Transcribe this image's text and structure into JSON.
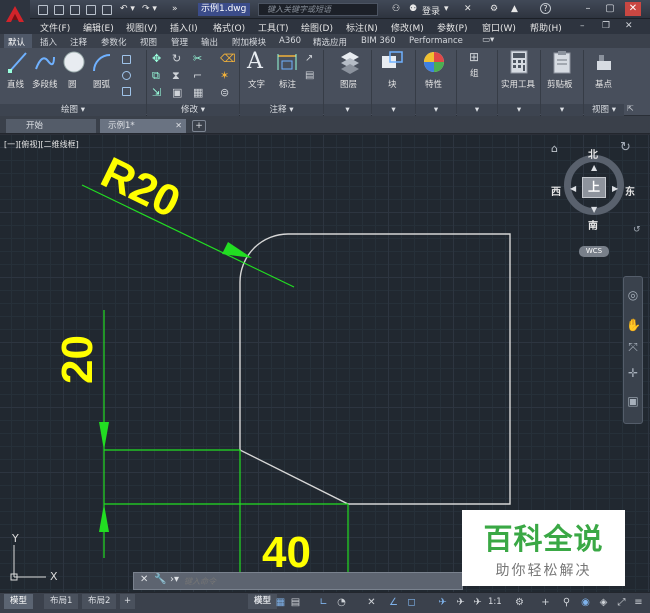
{
  "titlebar": {
    "document_title": "示例1.dwg",
    "search_placeholder": "键入关键字或短语",
    "login_label": "登录",
    "help_label": "?"
  },
  "menubar": {
    "items": [
      "文件(F)",
      "编辑(E)",
      "视图(V)",
      "插入(I)",
      "格式(O)",
      "工具(T)",
      "绘图(D)",
      "标注(N)",
      "修改(M)",
      "参数(P)",
      "窗口(W)",
      "帮助(H)"
    ]
  },
  "ribbon_tabs": [
    "默认",
    "插入",
    "注释",
    "参数化",
    "视图",
    "管理",
    "输出",
    "附加模块",
    "A360",
    "精选应用",
    "BIM 360",
    "Performance"
  ],
  "ribbon": {
    "draw": {
      "line": "直线",
      "polyline": "多段线",
      "circle": "圆",
      "arc": "圆弧",
      "title": "绘图"
    },
    "modify": {
      "title": "修改"
    },
    "annotation": {
      "text": "文字",
      "dimension": "标注",
      "title": "注释"
    },
    "layers": "图层",
    "block": "块",
    "properties": "特性",
    "group": "组",
    "utilities": "实用工具",
    "clipboard": "剪贴板",
    "base": "基点",
    "view": {
      "title": "视图"
    }
  },
  "file_tabs": {
    "start": "开始",
    "active": "示例1*",
    "add": "+"
  },
  "viewport": {
    "label": "[一][俯视][二维线框]"
  },
  "viewcube": {
    "north": "北",
    "south": "南",
    "east": "东",
    "west": "西",
    "top": "上",
    "wcs": "WCS"
  },
  "drawing": {
    "radius_label": "R20",
    "vertical_dim": "20",
    "horizontal_dim": "40"
  },
  "ucs": {
    "x": "X",
    "y": "Y"
  },
  "commandline": {
    "placeholder": "键入命令"
  },
  "statusbar": {
    "tabs": [
      "模型",
      "布局1",
      "布局2"
    ],
    "add": "+",
    "model": "模型",
    "scale": "1:1"
  },
  "watermark": {
    "title": "百科全说",
    "subtitle": "助你轻松解决"
  },
  "colors": {
    "accent_green": "#00ff00",
    "dim_yellow": "#ffff00",
    "canvas_bg": "#212830",
    "brand_red": "#d2232a"
  }
}
